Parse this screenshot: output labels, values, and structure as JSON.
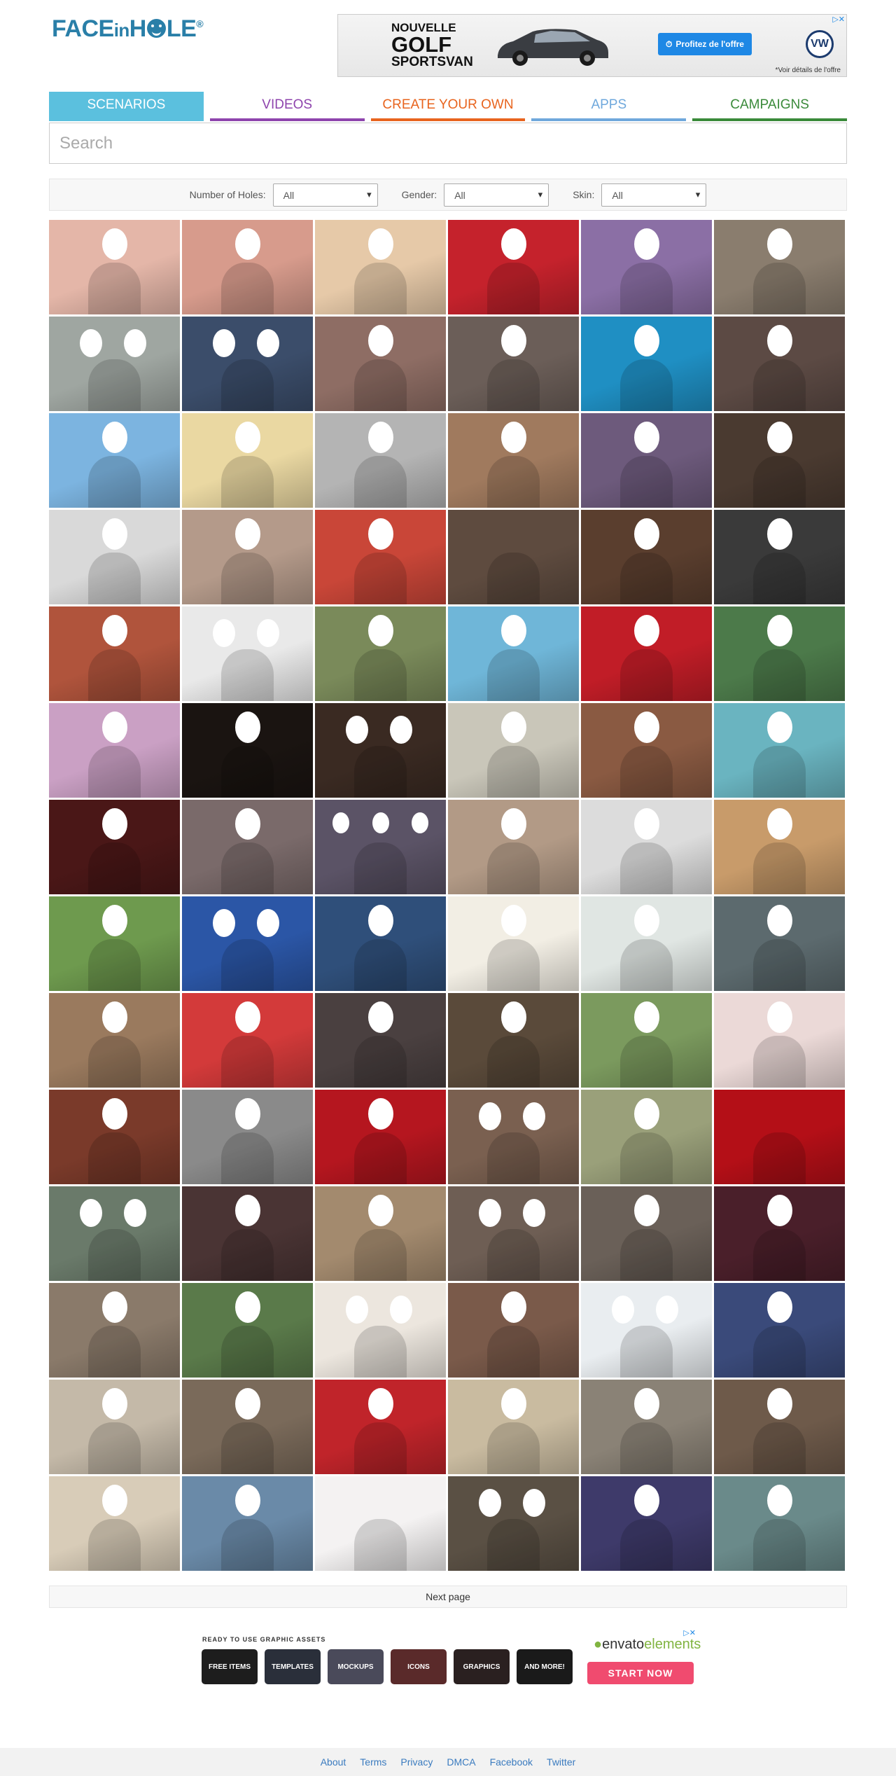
{
  "logo": {
    "part1": "FACE",
    "part2": "in",
    "part3": "H",
    "part4": "LE",
    "registered": "®"
  },
  "top_ad": {
    "line1": "NOUVELLE",
    "line2": "GOLF",
    "line3": "SPORTSVAN",
    "cta": "Profitez de l'offre",
    "brand": "VW",
    "fine_print": "*Voir détails de l'offre",
    "adchoices": "▷✕"
  },
  "tabs": [
    {
      "label": "SCENARIOS",
      "color": "#5bc0de",
      "active": true
    },
    {
      "label": "VIDEOS",
      "color": "#8e44ad",
      "active": false
    },
    {
      "label": "CREATE YOUR OWN",
      "color": "#e8641e",
      "active": false
    },
    {
      "label": "APPS",
      "color": "#6fa8dc",
      "active": false
    },
    {
      "label": "CAMPAIGNS",
      "color": "#3a8a3a",
      "active": false
    }
  ],
  "search": {
    "placeholder": "Search"
  },
  "filters": [
    {
      "label": "Number of Holes:",
      "value": "All"
    },
    {
      "label": "Gender:",
      "value": "All"
    },
    {
      "label": "Skin:",
      "value": "All"
    }
  ],
  "thumbnails": [
    {
      "bg": "#e4b6a8",
      "faces": 1
    },
    {
      "bg": "#d79b8c",
      "faces": 1
    },
    {
      "bg": "#e6c9a8",
      "faces": 1
    },
    {
      "bg": "#c5222c",
      "faces": 1
    },
    {
      "bg": "#8b6fa5",
      "faces": 1
    },
    {
      "bg": "#8a7d6e",
      "faces": 1
    },
    {
      "bg": "#9fa6a1",
      "faces": 2
    },
    {
      "bg": "#3b4d6a",
      "faces": 2
    },
    {
      "bg": "#8e6d64",
      "faces": 1
    },
    {
      "bg": "#6b5e58",
      "faces": 1
    },
    {
      "bg": "#1f8fc3",
      "faces": 1
    },
    {
      "bg": "#5c4a44",
      "faces": 1
    },
    {
      "bg": "#7cb4e0",
      "faces": 1
    },
    {
      "bg": "#ead8a2",
      "faces": 1
    },
    {
      "bg": "#b4b4b4",
      "faces": 1
    },
    {
      "bg": "#a07a5e",
      "faces": 1
    },
    {
      "bg": "#6d5a7c",
      "faces": 1
    },
    {
      "bg": "#4a3a30",
      "faces": 1
    },
    {
      "bg": "#d9d9d9",
      "faces": 1
    },
    {
      "bg": "#b49a8a",
      "faces": 1
    },
    {
      "bg": "#c94638",
      "faces": 1
    },
    {
      "bg": "#5e4b3f",
      "faces": 0
    },
    {
      "bg": "#5a3e2e",
      "faces": 1
    },
    {
      "bg": "#3a3a3a",
      "faces": 1
    },
    {
      "bg": "#b0543c",
      "faces": 1
    },
    {
      "bg": "#e9e9e9",
      "faces": 2
    },
    {
      "bg": "#7a8a5a",
      "faces": 1
    },
    {
      "bg": "#6fb6d8",
      "faces": 1
    },
    {
      "bg": "#c11d27",
      "faces": 1
    },
    {
      "bg": "#4c7a4a",
      "faces": 1
    },
    {
      "bg": "#caa0c4",
      "faces": 1
    },
    {
      "bg": "#1a1411",
      "faces": 1
    },
    {
      "bg": "#3a2a22",
      "faces": 2
    },
    {
      "bg": "#c9c6b9",
      "faces": 1
    },
    {
      "bg": "#8a5a42",
      "faces": 1
    },
    {
      "bg": "#6ab4c0",
      "faces": 1
    },
    {
      "bg": "#4a1717",
      "faces": 1
    },
    {
      "bg": "#7a6a6a",
      "faces": 1
    },
    {
      "bg": "#5b5366",
      "faces": 3
    },
    {
      "bg": "#b29a86",
      "faces": 1
    },
    {
      "bg": "#dcdcdc",
      "faces": 1
    },
    {
      "bg": "#c89b6a",
      "faces": 1
    },
    {
      "bg": "#6e9a4e",
      "faces": 1
    },
    {
      "bg": "#2b56a6",
      "faces": 2
    },
    {
      "bg": "#2f4f7a",
      "faces": 1
    },
    {
      "bg": "#f2eee4",
      "faces": 1
    },
    {
      "bg": "#e0e6e3",
      "faces": 1
    },
    {
      "bg": "#5c6a6e",
      "faces": 1
    },
    {
      "bg": "#9a7a5e",
      "faces": 1
    },
    {
      "bg": "#d33a3a",
      "faces": 1
    },
    {
      "bg": "#4a4040",
      "faces": 1
    },
    {
      "bg": "#5a4a3a",
      "faces": 1
    },
    {
      "bg": "#7b9a5e",
      "faces": 1
    },
    {
      "bg": "#ebd9d7",
      "faces": 1
    },
    {
      "bg": "#7a3a2a",
      "faces": 1
    },
    {
      "bg": "#8a8a8a",
      "faces": 1
    },
    {
      "bg": "#b5161f",
      "faces": 1
    },
    {
      "bg": "#7a6050",
      "faces": 2
    },
    {
      "bg": "#9aa07a",
      "faces": 1
    },
    {
      "bg": "#b40f17",
      "faces": 0
    },
    {
      "bg": "#6a7a6a",
      "faces": 2
    },
    {
      "bg": "#4a3434",
      "faces": 1
    },
    {
      "bg": "#a38a6e",
      "faces": 1
    },
    {
      "bg": "#6e5e54",
      "faces": 2
    },
    {
      "bg": "#6a6058",
      "faces": 1
    },
    {
      "bg": "#4a1f2a",
      "faces": 1
    },
    {
      "bg": "#8a7a6a",
      "faces": 1
    },
    {
      "bg": "#5a7a4a",
      "faces": 1
    },
    {
      "bg": "#ece6de",
      "faces": 2
    },
    {
      "bg": "#7a5a4a",
      "faces": 1
    },
    {
      "bg": "#e9edf0",
      "faces": 2
    },
    {
      "bg": "#3a4a7a",
      "faces": 1
    },
    {
      "bg": "#c4b9a8",
      "faces": 1
    },
    {
      "bg": "#7a6a5a",
      "faces": 1
    },
    {
      "bg": "#c0242a",
      "faces": 1
    },
    {
      "bg": "#c9bba0",
      "faces": 1
    },
    {
      "bg": "#8a8276",
      "faces": 1
    },
    {
      "bg": "#6e5a4a",
      "faces": 1
    },
    {
      "bg": "#d8ccb8",
      "faces": 1
    },
    {
      "bg": "#6a8aa8",
      "faces": 1
    },
    {
      "bg": "#f4f2f2",
      "faces": 0
    },
    {
      "bg": "#5a5044",
      "faces": 2
    },
    {
      "bg": "#3e3a6a",
      "faces": 1
    },
    {
      "bg": "#6a8a8a",
      "faces": 1
    }
  ],
  "next_page": "Next page",
  "bottom_ad": {
    "tagline": "READY TO USE GRAPHIC ASSETS",
    "items": [
      "FREE ITEMS",
      "TEMPLATES",
      "MOCKUPS",
      "ICONS",
      "GRAPHICS",
      "AND MORE!"
    ],
    "brand_prefix": "envato",
    "brand_suffix": "elements",
    "cta": "START NOW",
    "adchoices": "▷✕"
  },
  "footer_links": [
    "About",
    "Terms",
    "Privacy",
    "DMCA",
    "Facebook",
    "Twitter"
  ]
}
